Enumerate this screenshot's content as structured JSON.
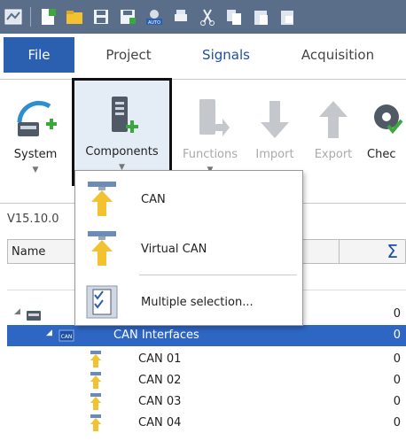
{
  "ribbon_tabs": [
    "File",
    "Project",
    "Signals",
    "Acquisition"
  ],
  "ribbon_buttons": {
    "system": "System",
    "components": "Components",
    "functions": "Functions",
    "import": "Import",
    "export": "Export",
    "check": "Chec"
  },
  "components_menu": {
    "items": [
      "CAN",
      "Virtual CAN",
      "Multiple selection..."
    ]
  },
  "tree": {
    "version_label": "V15.10.0",
    "column_name": "Name",
    "column_sum": "Σ",
    "rows": [
      {
        "label": "",
        "count": "0"
      },
      {
        "label": "CAN Interfaces",
        "count": "0"
      },
      {
        "label": "CAN 01",
        "count": "0"
      },
      {
        "label": "CAN 02",
        "count": "0"
      },
      {
        "label": "CAN 03",
        "count": "0"
      },
      {
        "label": "CAN 04",
        "count": "0"
      }
    ]
  },
  "colors": {
    "title_bar": "#5a6e8a",
    "file_tab": "#2b5fb0",
    "selection": "#2e66c4",
    "accent_green": "#3aa83a",
    "arrow_yellow": "#f2c230"
  }
}
